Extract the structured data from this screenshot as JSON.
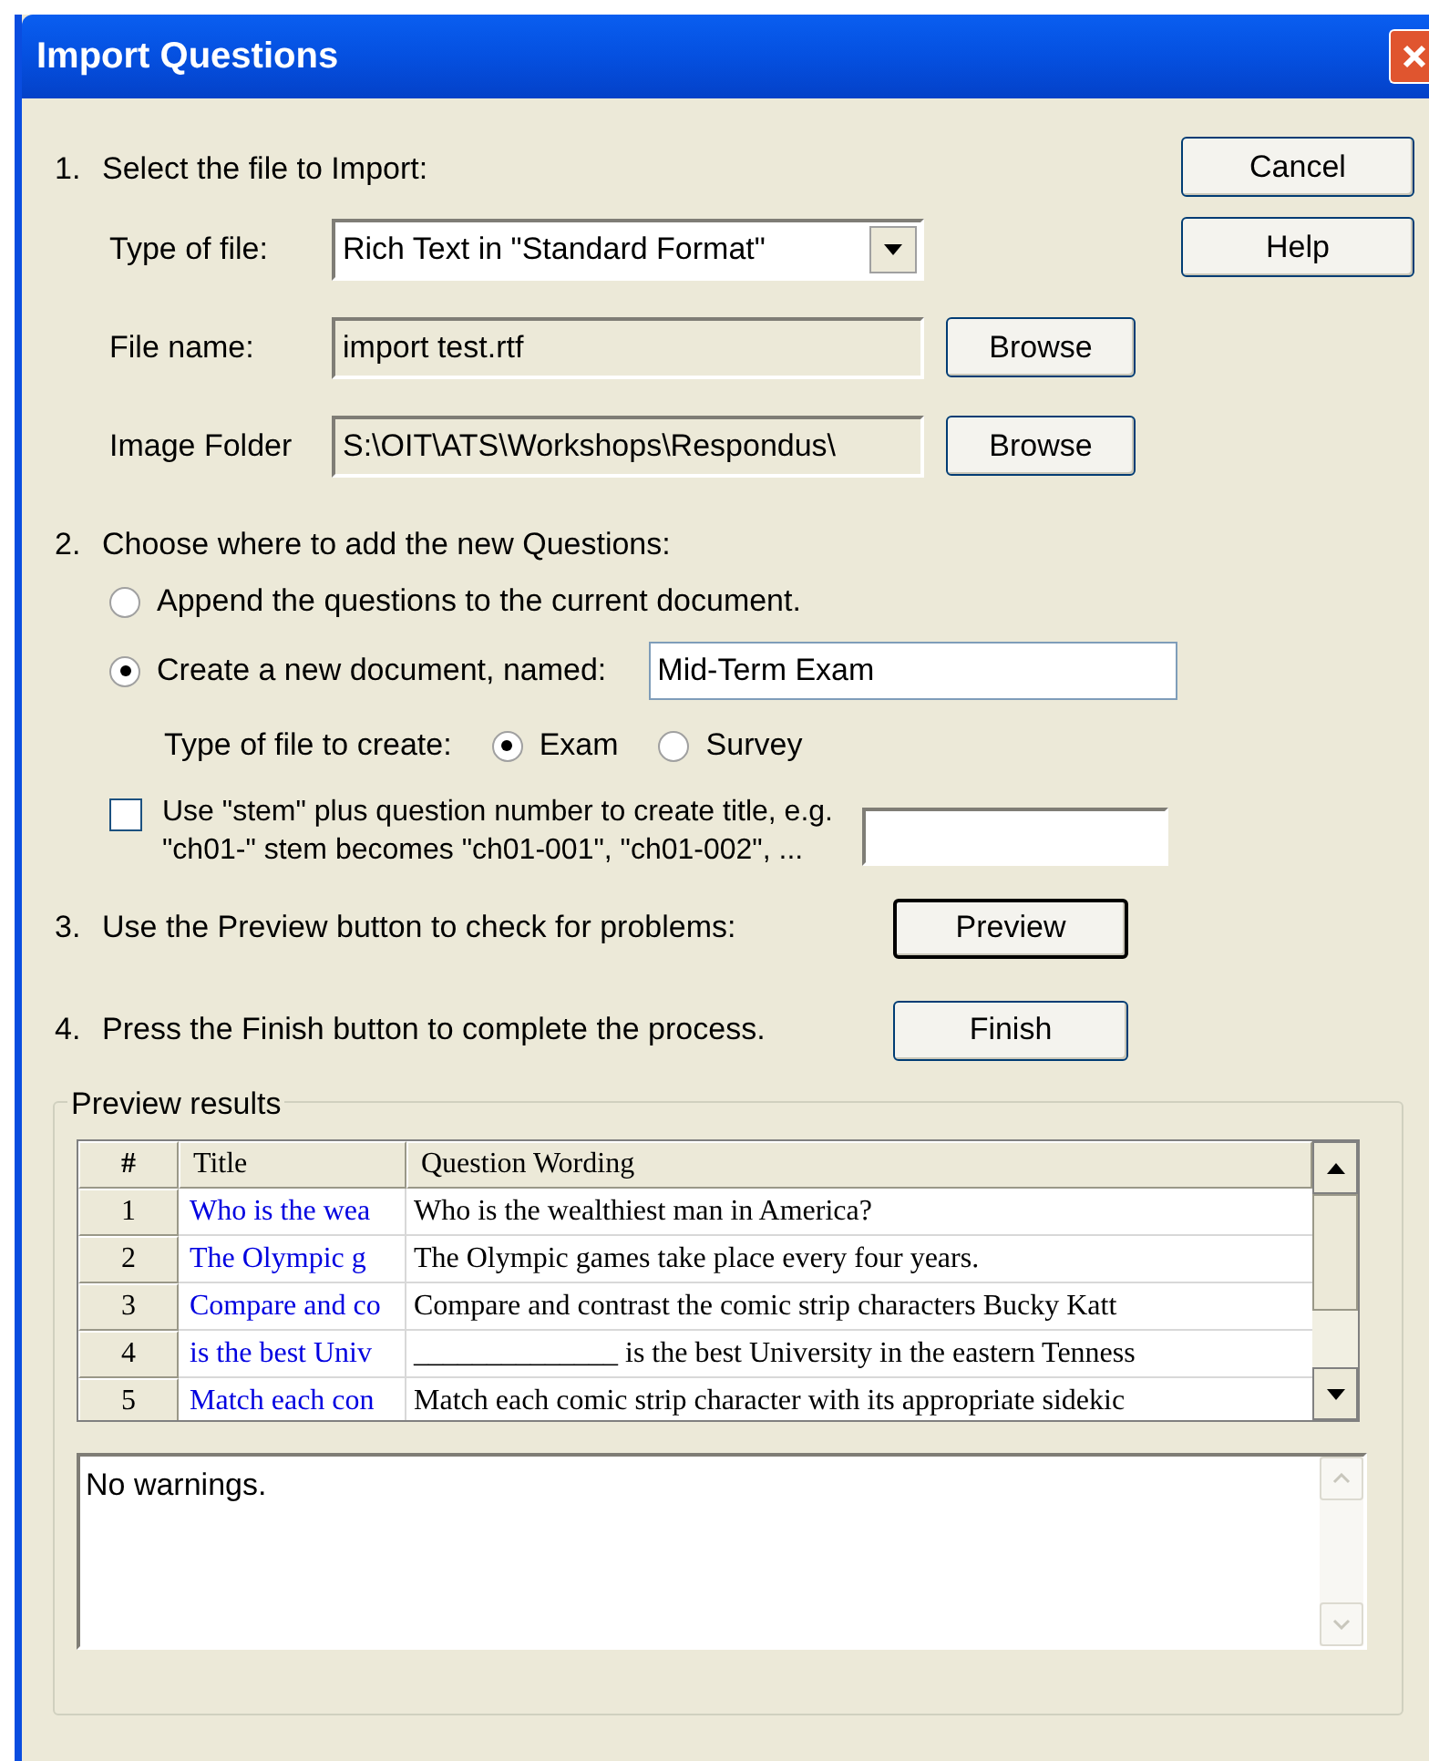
{
  "window": {
    "title": "Import Questions"
  },
  "side_buttons": [
    {
      "label": "Cancel"
    },
    {
      "label": "Help"
    }
  ],
  "step1": {
    "number": "1.",
    "text": "Select the file to Import:",
    "fields": [
      {
        "kind": "dropdown",
        "label": "Type of file:",
        "value": "Rich Text in \"Standard Format\""
      },
      {
        "kind": "readonly",
        "label": "File name:",
        "value": "import test.rtf",
        "button": "Browse"
      },
      {
        "kind": "readonly",
        "label": "Image Folder",
        "value": "S:\\OIT\\ATS\\Workshops\\Respondus\\",
        "button": "Browse"
      }
    ]
  },
  "step2": {
    "number": "2.",
    "text": "Choose where to add the new Questions:",
    "destinations": [
      {
        "label": "Append the questions to the current document.",
        "selected": false
      },
      {
        "label": "Create a new document, named:",
        "selected": true,
        "value": "Mid-Term Exam"
      }
    ],
    "file_type": {
      "label": "Type of file to create:",
      "options": [
        {
          "label": "Exam",
          "selected": true
        },
        {
          "label": "Survey",
          "selected": false
        }
      ]
    },
    "stem": {
      "checked": false,
      "line1": "Use \"stem\" plus question number to create title,  e.g.",
      "line2": "\"ch01-\" stem becomes \"ch01-001\",  \"ch01-002\",  ..."
    }
  },
  "step3": {
    "number": "3.",
    "text": "Use the Preview button to check for problems:",
    "button": "Preview"
  },
  "step4": {
    "number": "4.",
    "text": "Press the Finish button to complete the process.",
    "button": "Finish"
  },
  "preview": {
    "legend": "Preview results",
    "columns": [
      "#",
      "Title",
      "Question Wording"
    ],
    "rows": [
      {
        "number": "1",
        "title": "Who is the wea",
        "wording": "Who is the wealthiest man in America?"
      },
      {
        "number": "2",
        "title": "The Olympic g",
        "wording": "The Olympic games take place every four years."
      },
      {
        "number": "3",
        "title": "Compare and co",
        "wording": "Compare and contrast the comic strip characters Bucky Katt"
      },
      {
        "number": "4",
        "title": "is the best Univ",
        "wording": "______________ is the best University in the eastern Tenness"
      },
      {
        "number": "5",
        "title": "Match each con",
        "wording": "Match each comic strip character with its appropriate sidekic"
      }
    ],
    "warnings": "No warnings."
  }
}
